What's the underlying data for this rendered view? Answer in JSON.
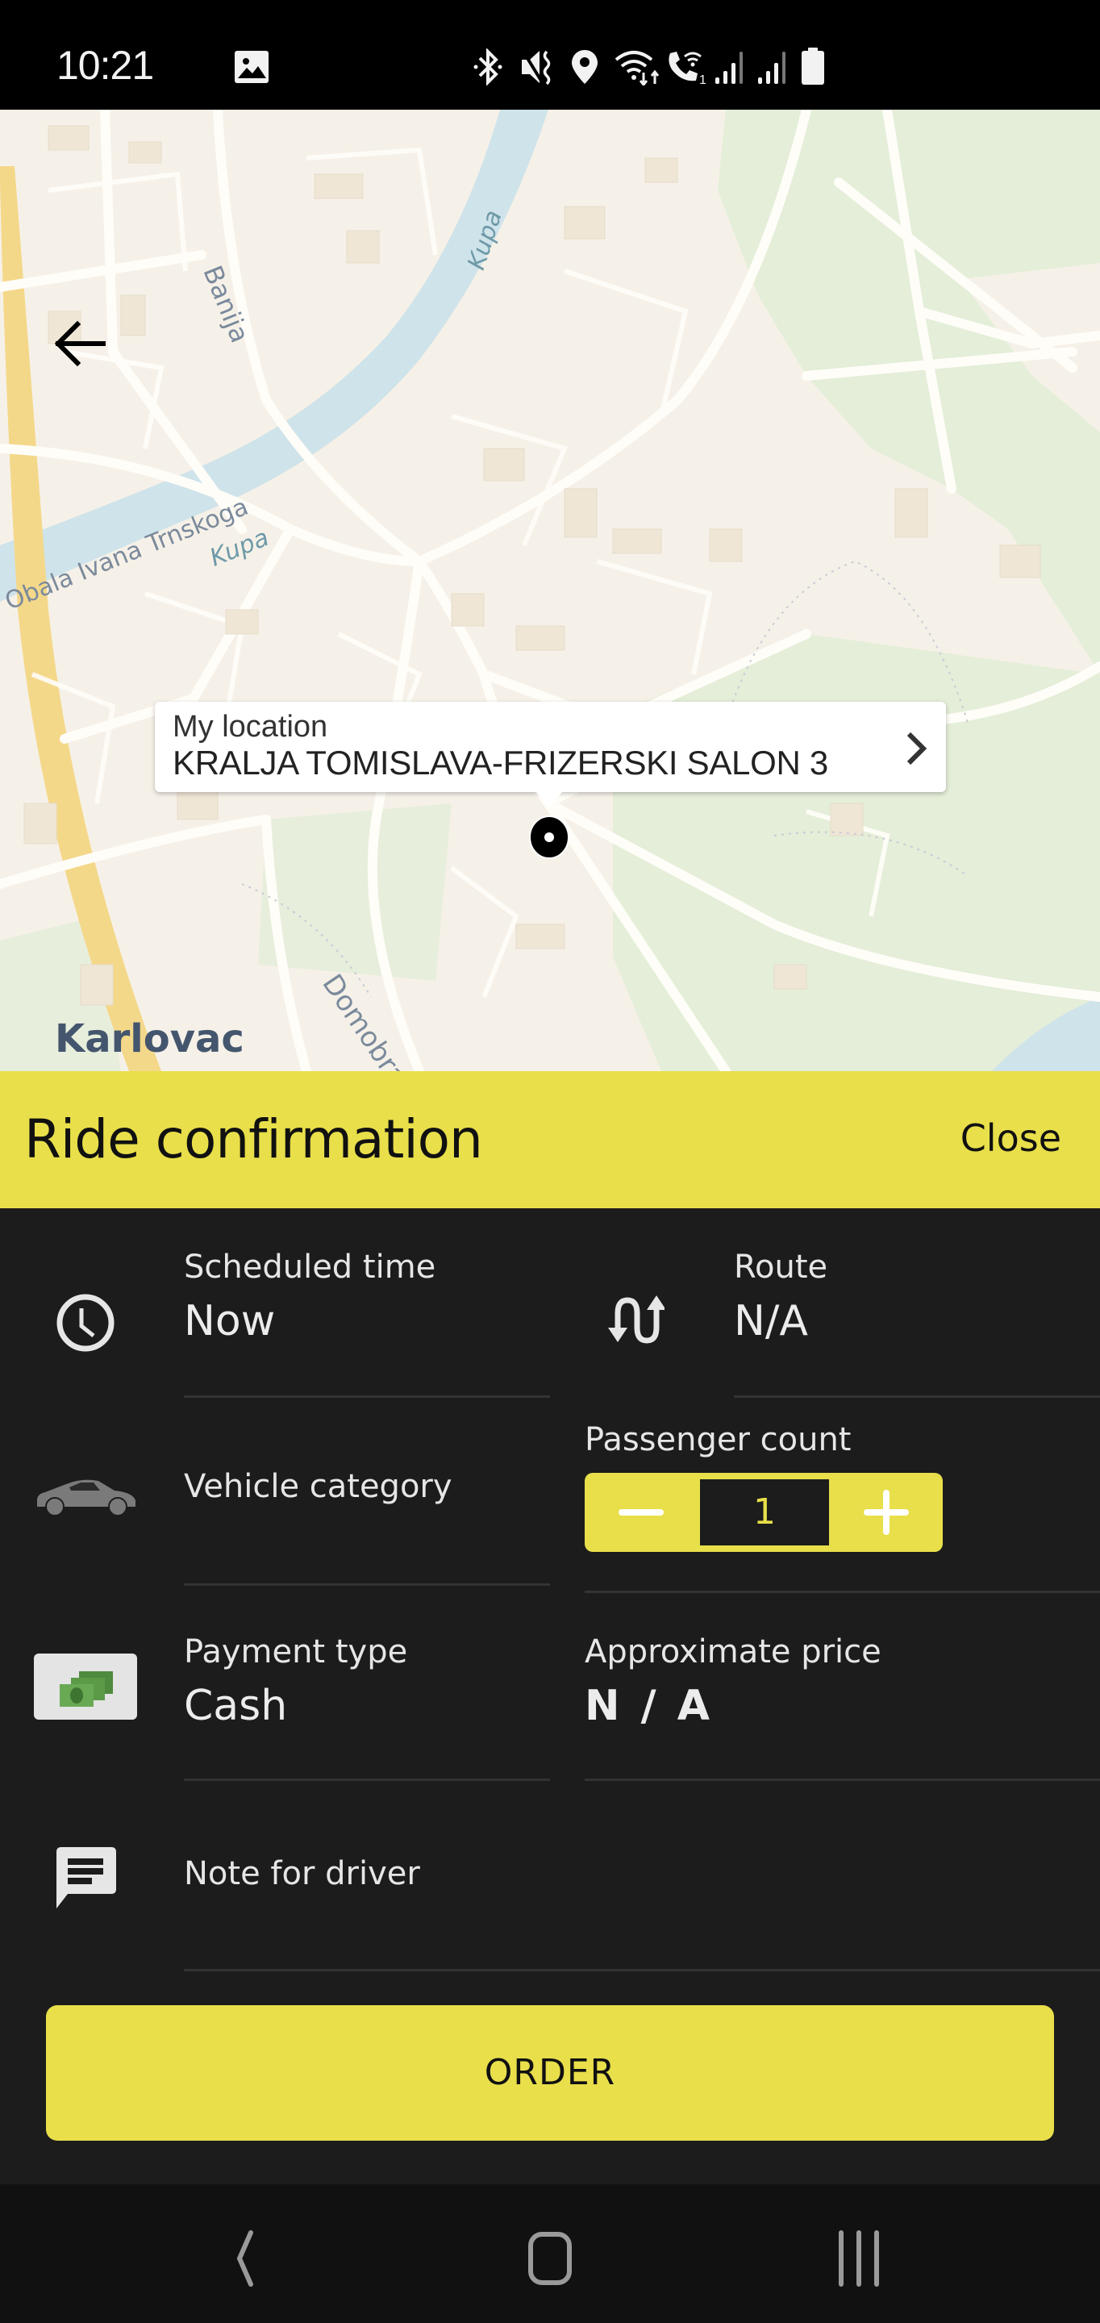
{
  "status_bar": {
    "time": "10:21",
    "icons": [
      "gallery-notification-icon",
      "bluetooth-icon",
      "vibrate-mute-icon",
      "location-icon",
      "wifi-data-icon",
      "wifi-calling-icon",
      "signal-sim1-icon",
      "signal-sim2-icon",
      "battery-icon"
    ],
    "wifi_calling_sim": "1"
  },
  "map": {
    "labels": {
      "banija": "Banija",
      "kupa_upper": "Kupa",
      "kupa_lower": "Kupa",
      "obala": "Obala Ivana Trnskoga",
      "domobran": "Domobran",
      "city": "Karlovac"
    },
    "callout": {
      "label": "My location",
      "address": "KRALJA TOMISLAVA-FRIZERSKI SALON 3"
    },
    "colors": {
      "land": "#f6f1e8",
      "park": "#e4eed8",
      "water": "#cfe3ea",
      "road": "#fffdf8",
      "highway": "#f4d88a"
    }
  },
  "sheet": {
    "title": "Ride confirmation",
    "close_label": "Close",
    "fields": {
      "scheduled_time": {
        "label": "Scheduled time",
        "value": "Now",
        "icon": "clock-icon"
      },
      "route": {
        "label": "Route",
        "value": "N/A",
        "icon": "route-icon"
      },
      "vehicle_category": {
        "label": "Vehicle category",
        "icon": "car-icon"
      },
      "passenger_count": {
        "label": "Passenger count",
        "value": "1"
      },
      "payment_type": {
        "label": "Payment type",
        "value": "Cash",
        "icon": "cash-icon"
      },
      "approximate_price": {
        "label": "Approximate price",
        "value": "N / A"
      },
      "note_for_driver": {
        "label": "Note for driver",
        "icon": "note-icon"
      }
    },
    "order_label": "ORDER",
    "accent_color": "#e8df4a",
    "background_color": "#1c1c1c"
  },
  "nav_bar": {
    "buttons": [
      "back",
      "home",
      "recents"
    ]
  }
}
